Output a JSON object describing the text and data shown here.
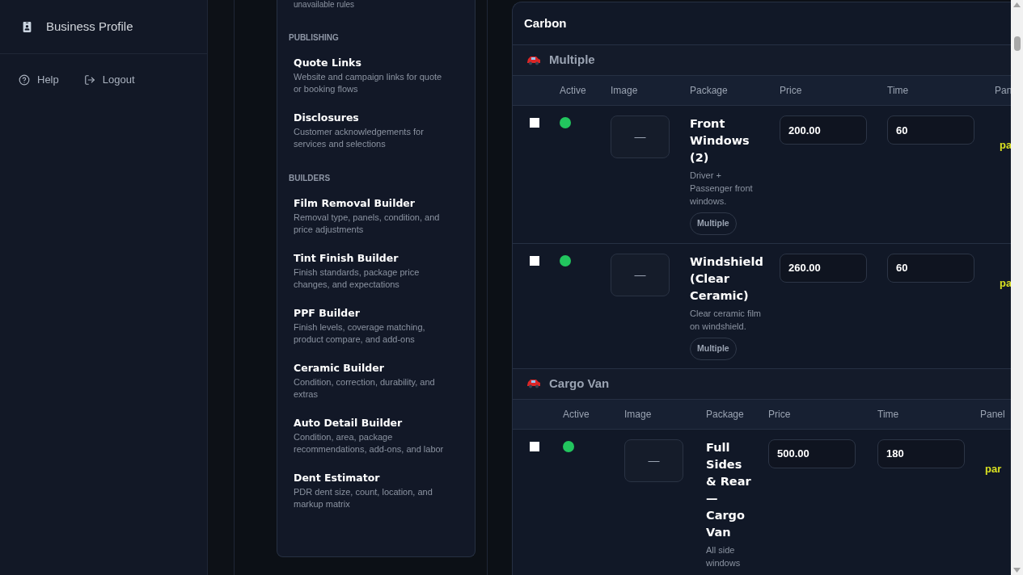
{
  "sidebar": {
    "items": [
      {
        "label": "Business Profile"
      }
    ],
    "footer_links": [
      "Help",
      "Logout"
    ]
  },
  "nav": {
    "partial_description": "unavailable rules",
    "sections": [
      {
        "heading": "PUBLISHING",
        "items": [
          {
            "title": "Quote Links",
            "description": "Website and campaign links for quote or booking flows"
          },
          {
            "title": "Disclosures",
            "description": "Customer acknowledgements for services and selections"
          }
        ]
      },
      {
        "heading": "BUILDERS",
        "items": [
          {
            "title": "Film Removal Builder",
            "description": "Removal type, panels, condition, and price adjustments"
          },
          {
            "title": "Tint Finish Builder",
            "description": "Finish standards, package price changes, and expectations"
          },
          {
            "title": "PPF Builder",
            "description": "Finish levels, coverage matching, product compare, and add-ons"
          },
          {
            "title": "Ceramic Builder",
            "description": "Condition, correction, durability, and extras"
          },
          {
            "title": "Auto Detail Builder",
            "description": "Condition, area, package recommendations, add-ons, and labor"
          },
          {
            "title": "Dent Estimator",
            "description": "PDR dent size, count, location, and markup matrix"
          }
        ]
      }
    ]
  },
  "panel": {
    "title": "Carbon",
    "groups": [
      {
        "name": "Multiple",
        "columns": [
          "Active",
          "Image",
          "Package",
          "Price",
          "Time",
          "Pan"
        ],
        "rows": [
          {
            "checked": false,
            "active": true,
            "image": "—",
            "name": "Front Windows (2)",
            "description": "Driver + Passenger front windows.",
            "tag": "Multiple",
            "price": "200.00",
            "time": "60",
            "panels": "pa"
          },
          {
            "checked": false,
            "active": true,
            "image": "—",
            "name": "Windshield (Clear Ceramic)",
            "description": "Clear ceramic film on windshield.",
            "tag": "Multiple",
            "price": "260.00",
            "time": "60",
            "panels": "pa"
          }
        ]
      },
      {
        "name": "Cargo Van",
        "columns": [
          "Active",
          "Image",
          "Package",
          "Price",
          "Time",
          "Panel"
        ],
        "rows": [
          {
            "checked": false,
            "active": true,
            "image": "—",
            "name": "Full Sides & Rear — Cargo Van",
            "description": "All side windows",
            "price": "500.00",
            "time": "180",
            "panels": "par"
          }
        ]
      }
    ]
  }
}
